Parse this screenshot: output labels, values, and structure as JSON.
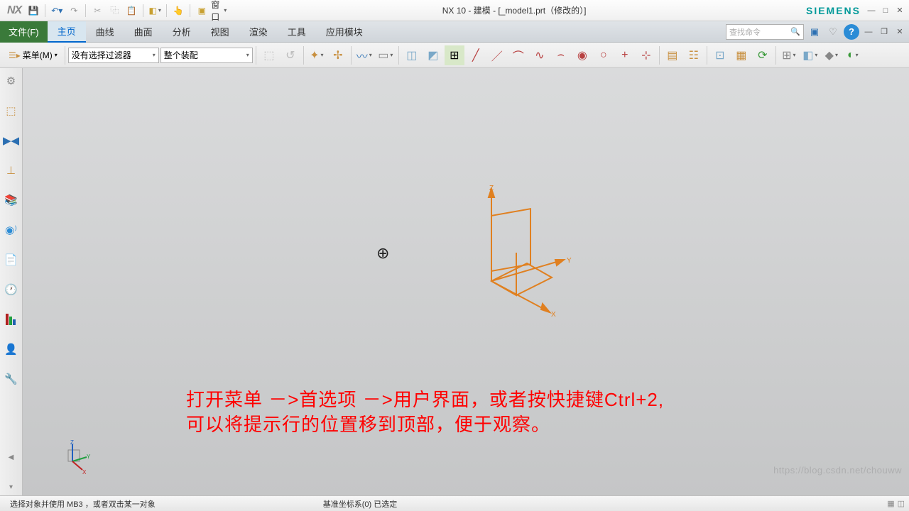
{
  "titlebar": {
    "app": "NX",
    "title": "NX 10 - 建模 - [_model1.prt（修改的）]",
    "brand": "SIEMENS",
    "window_menu": "窗口"
  },
  "menubar": {
    "file": "文件(F)",
    "tabs": [
      "主页",
      "曲线",
      "曲面",
      "分析",
      "视图",
      "渲染",
      "工具",
      "应用模块"
    ],
    "search_placeholder": "查找命令"
  },
  "toolbar": {
    "menu_label": "菜单(M)",
    "filter_select": "没有选择过滤器",
    "scope_select": "整个装配"
  },
  "overlay": {
    "line1": "打开菜单 －>首选项 －>用户界面，或者按快捷键Ctrl+2,",
    "line2": "可以将提示行的位置移到顶部，便于观察。"
  },
  "statusbar": {
    "hint": "选择对象并使用 MB3 ，或者双击某一对象",
    "selection": "基准坐标系(0) 已选定"
  },
  "axes": {
    "x": "X",
    "y": "Y",
    "z": "Z"
  },
  "watermark": "https://blog.csdn.net/chouww"
}
